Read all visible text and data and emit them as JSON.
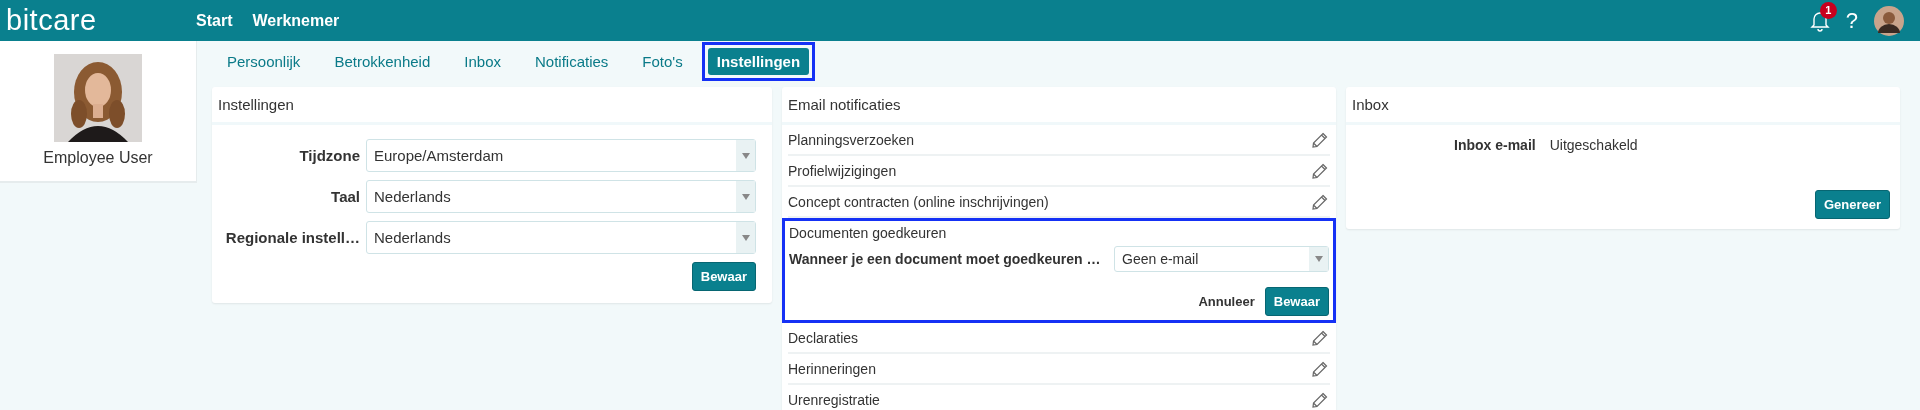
{
  "header": {
    "logo": "bitcare",
    "nav": [
      {
        "label": "Start"
      },
      {
        "label": "Werknemer"
      }
    ],
    "notification_count": "1",
    "help": "?"
  },
  "sidebar": {
    "user_name": "Employee User"
  },
  "tabs": [
    {
      "label": "Persoonlijk",
      "selected": false,
      "highlighted": false
    },
    {
      "label": "Betrokkenheid",
      "selected": false,
      "highlighted": false
    },
    {
      "label": "Inbox",
      "selected": false,
      "highlighted": false
    },
    {
      "label": "Notificaties",
      "selected": false,
      "highlighted": false
    },
    {
      "label": "Foto's",
      "selected": false,
      "highlighted": false
    },
    {
      "label": "Instellingen",
      "selected": true,
      "highlighted": true
    }
  ],
  "settings_panel": {
    "title": "Instellingen",
    "fields": [
      {
        "label": "Tijdzone",
        "value": "Europe/Amsterdam"
      },
      {
        "label": "Taal",
        "value": "Nederlands"
      },
      {
        "label": "Regionale instell…",
        "value": "Nederlands"
      }
    ],
    "save_button": "Bewaar"
  },
  "email_panel": {
    "title": "Email notificaties",
    "items": [
      {
        "kind": "row",
        "label": "Planningsverzoeken"
      },
      {
        "kind": "row",
        "label": "Profielwijzigingen"
      },
      {
        "kind": "row",
        "label": "Concept contracten (online inschrijvingen)"
      },
      {
        "kind": "editor",
        "label": "Documenten goedkeuren",
        "highlighted": true,
        "field_label": "Wanneer je een document moet goedkeuren …",
        "value": "Geen e-mail",
        "cancel_button": "Annuleer",
        "save_button": "Bewaar"
      },
      {
        "kind": "row",
        "label": "Declaraties"
      },
      {
        "kind": "row",
        "label": "Herinneringen"
      },
      {
        "kind": "row",
        "label": "Urenregistratie"
      }
    ]
  },
  "inbox_panel": {
    "title": "Inbox",
    "label": "Inbox e-mail",
    "value": "Uitgeschakeld",
    "button": "Genereer"
  }
}
